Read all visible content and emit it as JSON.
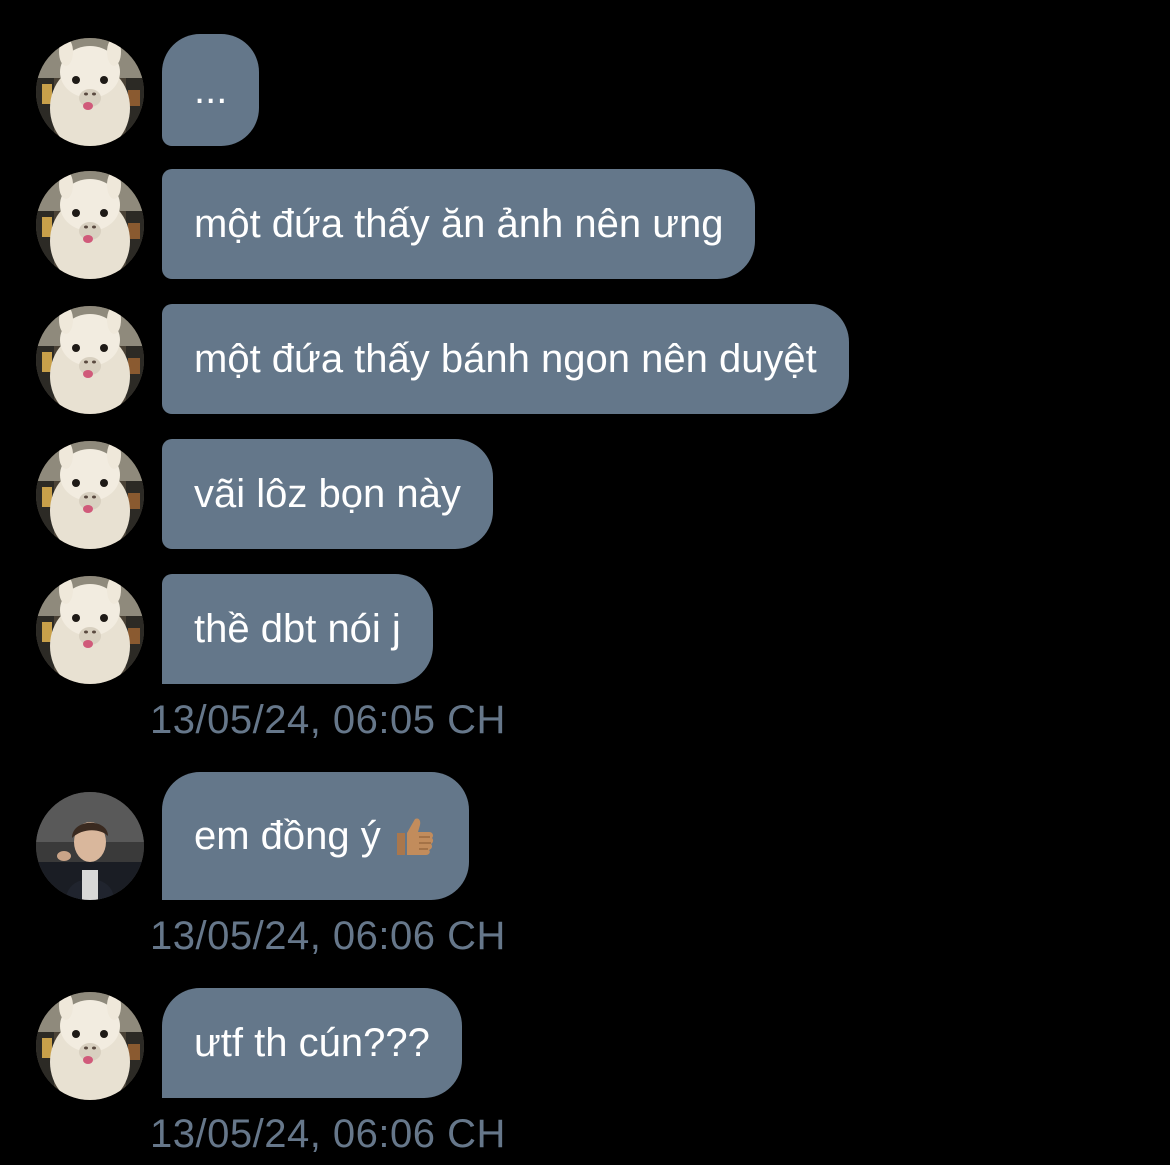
{
  "colors": {
    "background": "#000000",
    "bubble": "#64778a",
    "bubble_text": "#ffffff",
    "timestamp": "#66778a"
  },
  "messages": [
    {
      "sender": "alpaca-avatar",
      "text": "..."
    },
    {
      "sender": "alpaca-avatar",
      "text": "một đứa thấy ăn ảnh nên ưng"
    },
    {
      "sender": "alpaca-avatar",
      "text": "một đứa thấy bánh ngon nên duyệt"
    },
    {
      "sender": "alpaca-avatar",
      "text": "vãi lôz bọn này"
    },
    {
      "sender": "alpaca-avatar",
      "text": "thề dbt nói j"
    },
    {
      "sender": "person-avatar",
      "text": "em đồng ý",
      "emoji": "thumbs-up-icon"
    },
    {
      "sender": "alpaca-avatar",
      "text": "ưtf th cún???"
    }
  ],
  "timestamps": [
    "13/05/24, 06:05 CH",
    "13/05/24, 06:06 CH",
    "13/05/24, 06:06 CH"
  ]
}
